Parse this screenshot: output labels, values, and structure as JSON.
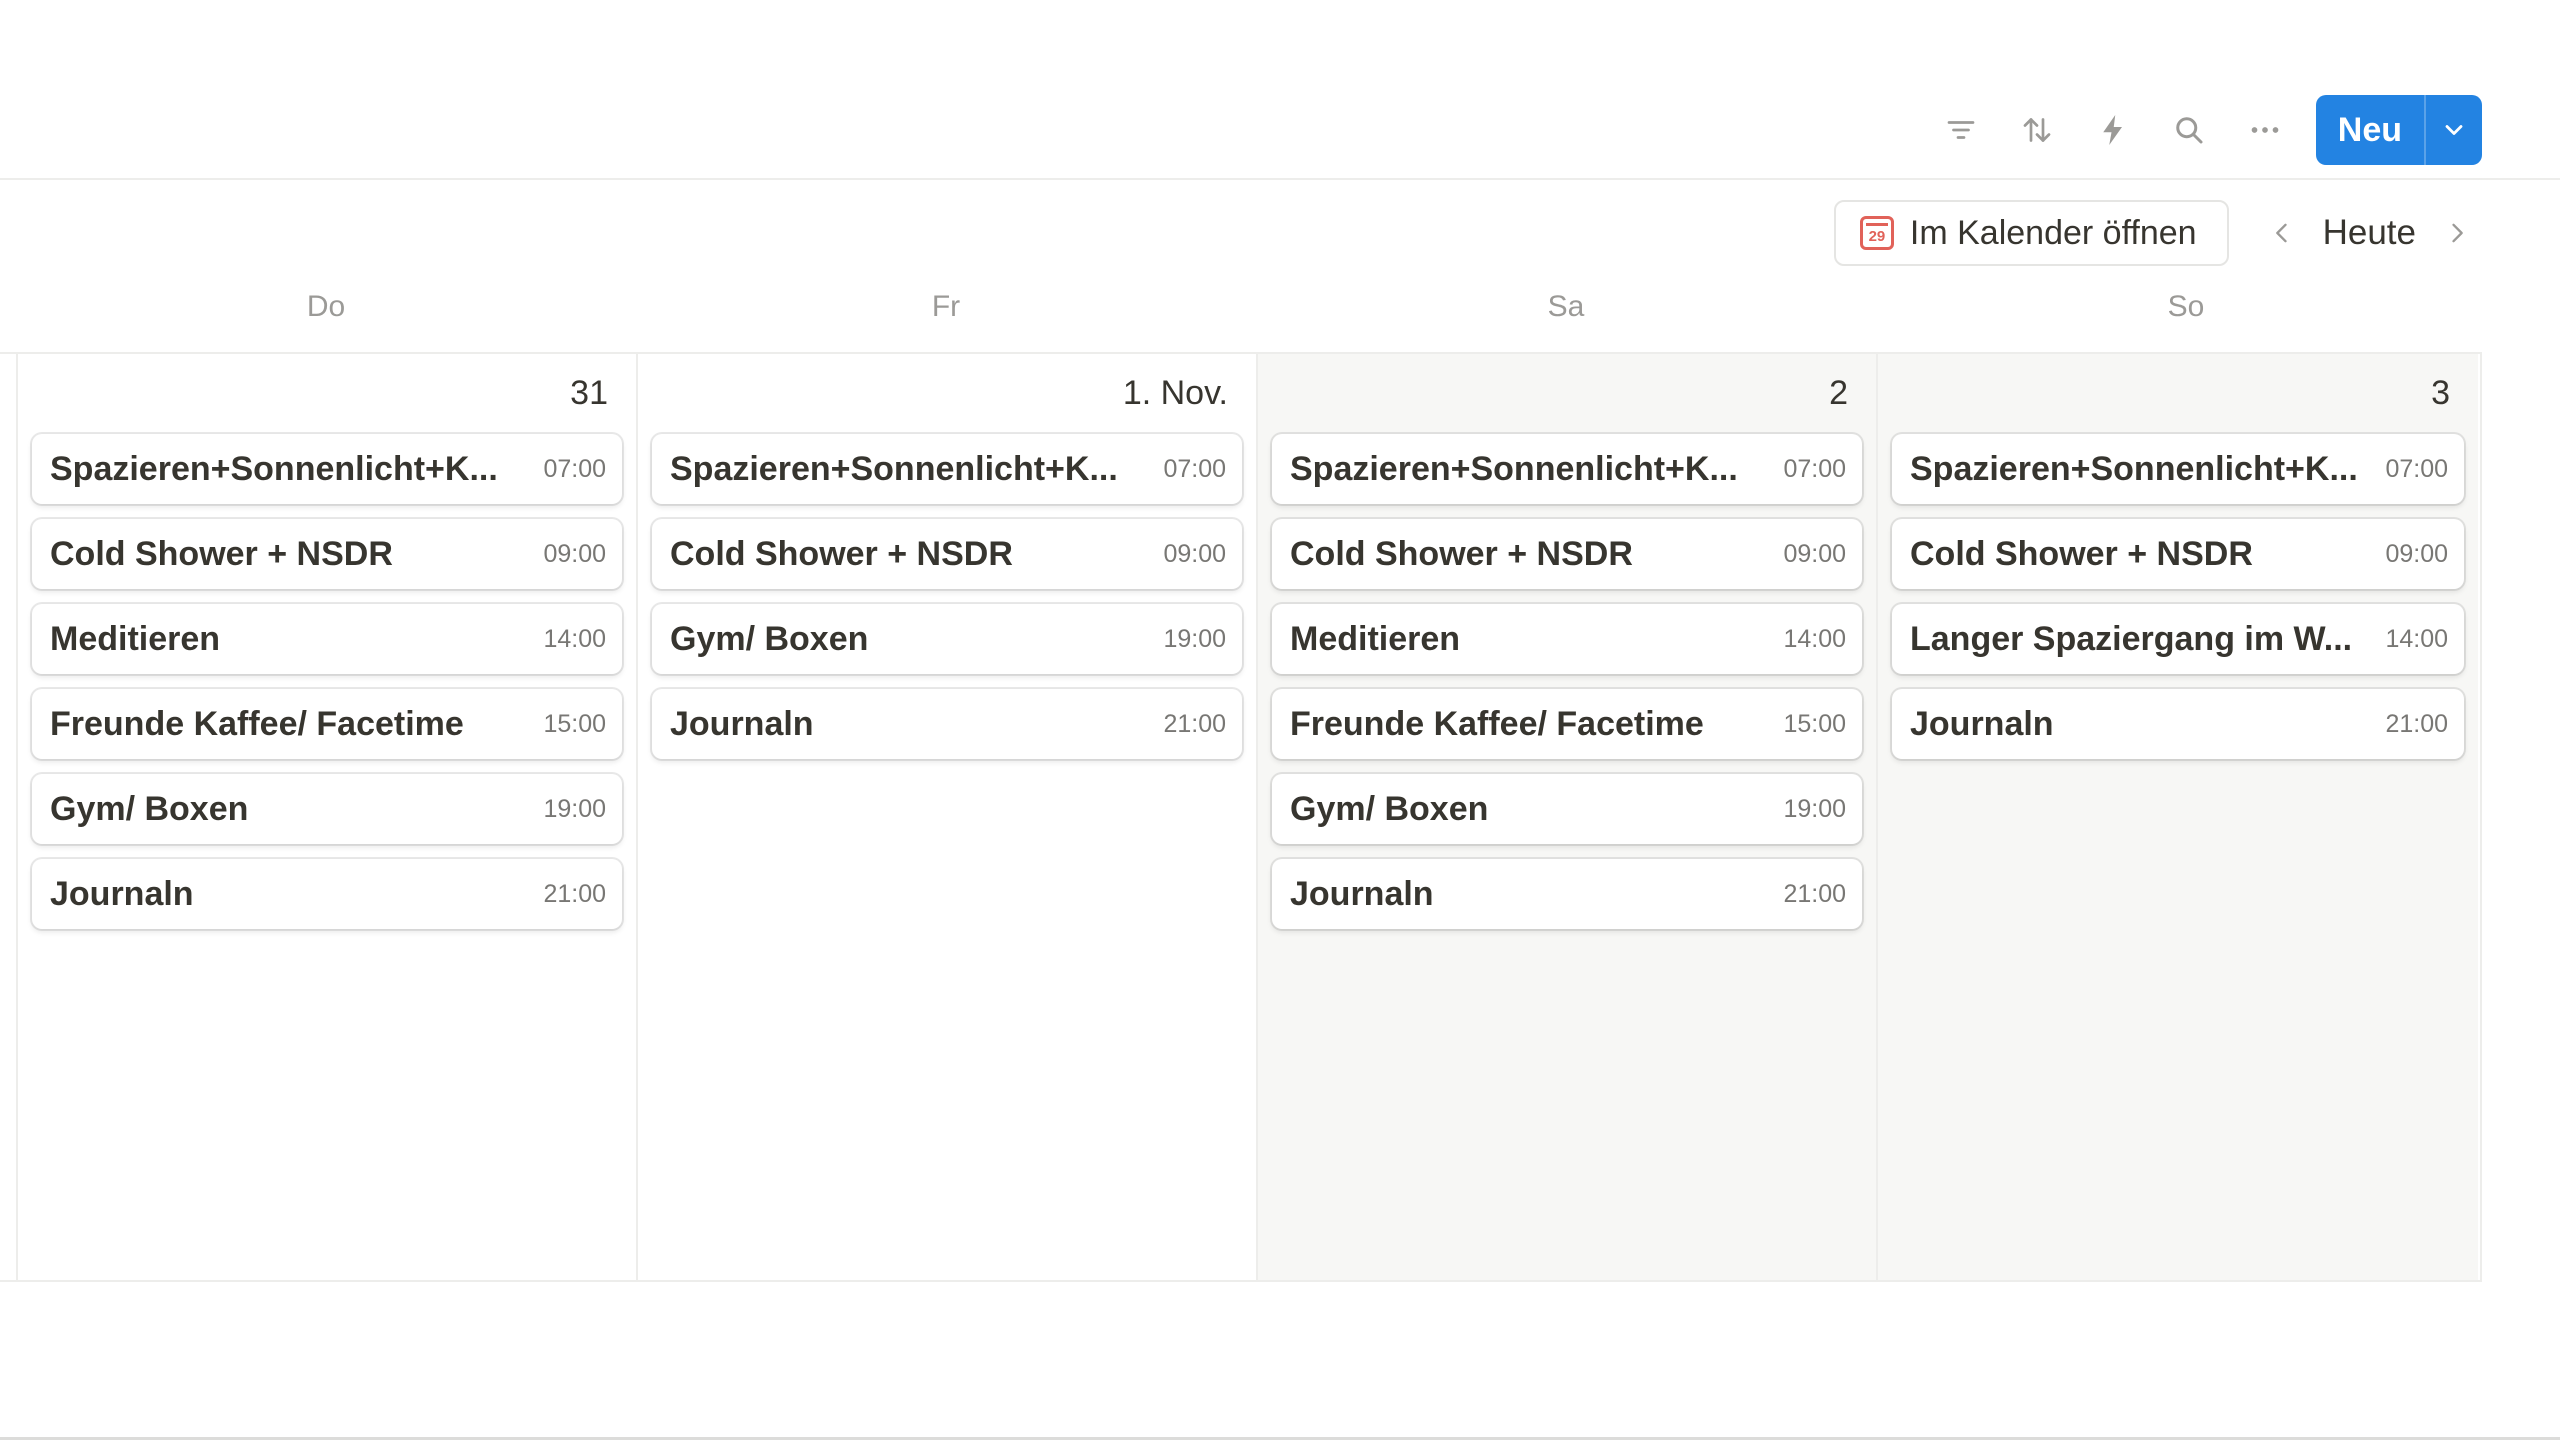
{
  "toolbar": {
    "icons": [
      "filter-icon",
      "sort-icon",
      "automation-bolt-icon",
      "search-icon",
      "more-icon"
    ],
    "new_label": "Neu"
  },
  "calendar_nav": {
    "open_calendar_label": "Im Kalender öffnen",
    "calendar_icon_day": "29",
    "today_label": "Heute"
  },
  "weekdays": [
    "Do",
    "Fr",
    "Sa",
    "So"
  ],
  "days": [
    {
      "number": "31",
      "weekend": false,
      "events": [
        {
          "title": "Spazieren+Sonnenlicht+K...",
          "time": "07:00"
        },
        {
          "title": "Cold Shower + NSDR",
          "time": "09:00"
        },
        {
          "title": "Meditieren",
          "time": "14:00"
        },
        {
          "title": "Freunde Kaffee/ Facetime",
          "time": "15:00"
        },
        {
          "title": "Gym/ Boxen",
          "time": "19:00"
        },
        {
          "title": "Journaln",
          "time": "21:00"
        }
      ]
    },
    {
      "number": "1. Nov.",
      "weekend": false,
      "events": [
        {
          "title": "Spazieren+Sonnenlicht+K...",
          "time": "07:00"
        },
        {
          "title": "Cold Shower + NSDR",
          "time": "09:00"
        },
        {
          "title": "Gym/ Boxen",
          "time": "19:00"
        },
        {
          "title": "Journaln",
          "time": "21:00"
        }
      ]
    },
    {
      "number": "2",
      "weekend": true,
      "events": [
        {
          "title": "Spazieren+Sonnenlicht+K...",
          "time": "07:00"
        },
        {
          "title": "Cold Shower + NSDR",
          "time": "09:00"
        },
        {
          "title": "Meditieren",
          "time": "14:00"
        },
        {
          "title": "Freunde Kaffee/ Facetime",
          "time": "15:00"
        },
        {
          "title": "Gym/ Boxen",
          "time": "19:00"
        },
        {
          "title": "Journaln",
          "time": "21:00"
        }
      ]
    },
    {
      "number": "3",
      "weekend": true,
      "events": [
        {
          "title": "Spazieren+Sonnenlicht+K...",
          "time": "07:00"
        },
        {
          "title": "Cold Shower + NSDR",
          "time": "09:00"
        },
        {
          "title": "Langer Spaziergang im W...",
          "time": "14:00"
        },
        {
          "title": "Journaln",
          "time": "21:00"
        }
      ]
    }
  ],
  "colors": {
    "accent": "#2383e2",
    "weekend_bg": "#f7f7f5",
    "border": "#ededeb",
    "calendar_icon": "#e16259"
  }
}
